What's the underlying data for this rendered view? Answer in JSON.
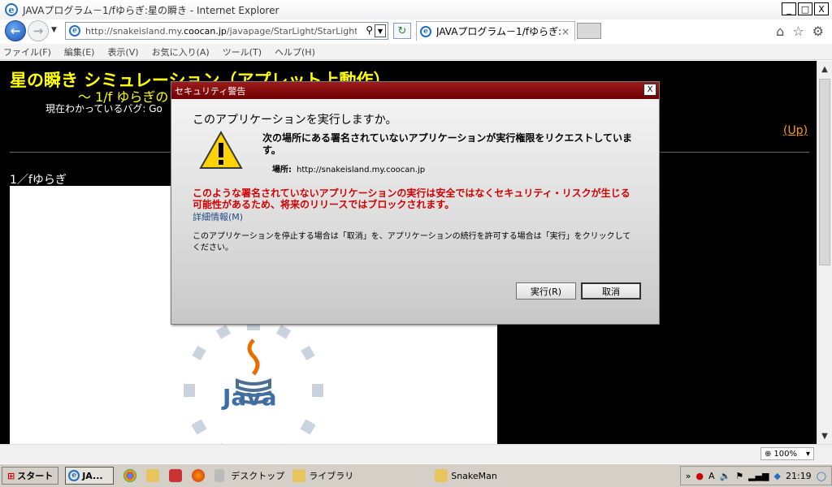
{
  "window": {
    "title": "JAVAプログラム－1/fゆらぎ:星の瞬き - Internet Explorer",
    "controls": [
      "_",
      "□",
      "X"
    ]
  },
  "address_bar": {
    "url_prefix": "http://snakeisland.my.",
    "url_domain": "coocan.jp",
    "url_suffix": "/javapage/StarLight/StarLightApp"
  },
  "tab": {
    "title": "JAVAプログラム－1/fゆらぎ:...",
    "close": "×"
  },
  "menu": [
    "ファイル(F)",
    "編集(E)",
    "表示(V)",
    "お気に入り(A)",
    "ツール(T)",
    "ヘルプ(H)"
  ],
  "page": {
    "title": "星の瞬き シミュレーション（アプレット上動作）",
    "subtitle": "～ 1/f ゆらぎの",
    "bugs": "現在わかっているバグ: Go",
    "up_link": "(Up)",
    "section_label": "1／fゆらぎ",
    "java_text": "Java"
  },
  "status": {
    "zoom": "100%"
  },
  "taskbar": {
    "start": "スタート",
    "active_task": "JA...",
    "desktop": "デスクトップ",
    "library": "ライブラリ",
    "app": "SnakeMan",
    "clock": "21:19"
  },
  "dialog": {
    "title": "セキュリティ警告",
    "close": "X",
    "heading": "このアプリケーションを実行しますか。",
    "request": "次の場所にある署名されていないアプリケーションが実行権限をリクエストしています。",
    "location_label": "場所:",
    "location_value": "http://snakeisland.my.coocan.jp",
    "warning": "このような署名されていないアプリケーションの実行は安全ではなくセキュリティ・リスクが生じる可能性があるため、将来のリリースではブロックされます。",
    "more_info": "詳細情報(M)",
    "instruction": "このアプリケーションを停止する場合は「取消」を、アプリケーションの続行を許可する場合は「実行」をクリックしてください。",
    "run_button": "実行(R)",
    "cancel_button": "取消"
  },
  "colors": {
    "page_bg": "#000000",
    "title_yellow": "#ffff00",
    "link_orange": "#ff9900",
    "warning_red": "#d10000",
    "dialog_title_red": "#8b0e0e"
  }
}
